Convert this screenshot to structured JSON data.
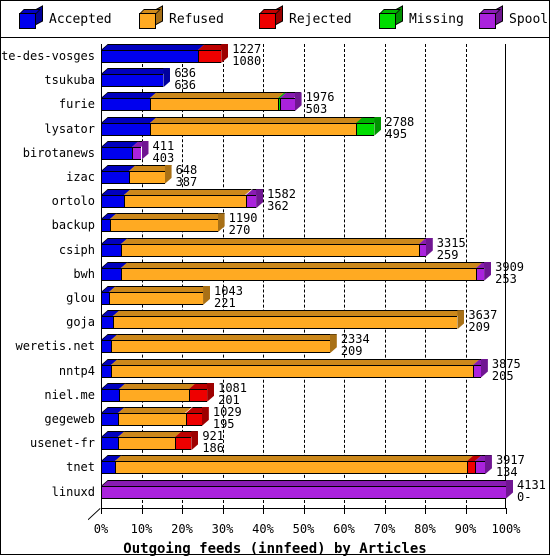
{
  "legend": {
    "items": [
      {
        "label": "Accepted",
        "color": "#0000ee",
        "icon": "cube-icon"
      },
      {
        "label": "Refused",
        "color": "#ffaa22",
        "icon": "cube-icon"
      },
      {
        "label": "Rejected",
        "color": "#ee0000",
        "icon": "cube-icon"
      },
      {
        "label": "Missing",
        "color": "#00dd00",
        "icon": "cube-icon"
      },
      {
        "label": "Spooled",
        "color": "#aa22dd",
        "icon": "cube-icon"
      }
    ]
  },
  "axis": {
    "title": "Outgoing feeds (innfeed) by Articles",
    "xticks": [
      "0%",
      "10%",
      "20%",
      "30%",
      "40%",
      "50%",
      "60%",
      "70%",
      "80%",
      "90%",
      "100%"
    ]
  },
  "chart_data": {
    "type": "bar",
    "title": "Outgoing feeds (innfeed) by Articles",
    "xlabel": "Outgoing feeds (innfeed) by Articles",
    "ylabel": "",
    "orientation": "horizontal",
    "stacked": true,
    "normalized_percent": true,
    "xlim": [
      0,
      100
    ],
    "xtick_labels": [
      "0%",
      "10%",
      "20%",
      "30%",
      "40%",
      "50%",
      "60%",
      "70%",
      "80%",
      "90%",
      "100%"
    ],
    "grid": true,
    "legend_position": "top",
    "series": [
      {
        "name": "Accepted",
        "color": "#0000ee"
      },
      {
        "name": "Refused",
        "color": "#ffaa22"
      },
      {
        "name": "Rejected",
        "color": "#ee0000"
      },
      {
        "name": "Missing",
        "color": "#00dd00"
      },
      {
        "name": "Spooled",
        "color": "#aa22dd"
      }
    ],
    "categories": [
      "bete-des-vosges",
      "tsukuba",
      "furie",
      "lysator",
      "birotanews",
      "izac",
      "ortolo",
      "backup",
      "csiph",
      "bwh",
      "glou",
      "goja",
      "weretis.net",
      "nntp4",
      "niel.me",
      "gegeweb",
      "usenet-fr",
      "tnet",
      "linuxd"
    ],
    "rows": [
      {
        "label": "bete-des-vosges",
        "total": 1227,
        "second": 1080,
        "pct_total": 29.7,
        "segments": [
          {
            "series": "Accepted",
            "pct": 24.0
          },
          {
            "series": "Rejected",
            "pct": 5.7
          }
        ]
      },
      {
        "label": "tsukuba",
        "total": 636,
        "second": 636,
        "pct_total": 15.4,
        "segments": [
          {
            "series": "Accepted",
            "pct": 15.4
          }
        ]
      },
      {
        "label": "furie",
        "total": 1976,
        "second": 503,
        "pct_total": 47.8,
        "segments": [
          {
            "series": "Accepted",
            "pct": 12.2
          },
          {
            "series": "Refused",
            "pct": 31.5
          },
          {
            "series": "Missing",
            "pct": 0.6
          },
          {
            "series": "Spooled",
            "pct": 3.5
          }
        ]
      },
      {
        "label": "lysator",
        "total": 2788,
        "second": 495,
        "pct_total": 67.5,
        "segments": [
          {
            "series": "Accepted",
            "pct": 12.0
          },
          {
            "series": "Refused",
            "pct": 51.0
          },
          {
            "series": "Missing",
            "pct": 4.5
          }
        ]
      },
      {
        "label": "birotanews",
        "total": 411,
        "second": 403,
        "pct_total": 10.0,
        "segments": [
          {
            "series": "Accepted",
            "pct": 7.7
          },
          {
            "series": "Spooled",
            "pct": 2.3
          }
        ]
      },
      {
        "label": "izac",
        "total": 648,
        "second": 387,
        "pct_total": 15.7,
        "segments": [
          {
            "series": "Accepted",
            "pct": 6.9
          },
          {
            "series": "Refused",
            "pct": 8.8
          }
        ]
      },
      {
        "label": "ortolo",
        "total": 1582,
        "second": 362,
        "pct_total": 38.3,
        "segments": [
          {
            "series": "Accepted",
            "pct": 5.8
          },
          {
            "series": "Refused",
            "pct": 29.9
          },
          {
            "series": "Spooled",
            "pct": 2.6
          }
        ]
      },
      {
        "label": "backup",
        "total": 1190,
        "second": 270,
        "pct_total": 28.8,
        "segments": [
          {
            "series": "Accepted",
            "pct": 2.2
          },
          {
            "series": "Refused",
            "pct": 26.6
          }
        ]
      },
      {
        "label": "csiph",
        "total": 3315,
        "second": 259,
        "pct_total": 80.2,
        "segments": [
          {
            "series": "Accepted",
            "pct": 5.0
          },
          {
            "series": "Refused",
            "pct": 73.5
          },
          {
            "series": "Spooled",
            "pct": 1.7
          }
        ]
      },
      {
        "label": "bwh",
        "total": 3909,
        "second": 253,
        "pct_total": 94.6,
        "segments": [
          {
            "series": "Accepted",
            "pct": 5.0
          },
          {
            "series": "Refused",
            "pct": 87.6
          },
          {
            "series": "Spooled",
            "pct": 2.0
          }
        ]
      },
      {
        "label": "glou",
        "total": 1043,
        "second": 221,
        "pct_total": 25.2,
        "segments": [
          {
            "series": "Accepted",
            "pct": 2.0
          },
          {
            "series": "Refused",
            "pct": 23.2
          }
        ]
      },
      {
        "label": "goja",
        "total": 3637,
        "second": 209,
        "pct_total": 88.0,
        "segments": [
          {
            "series": "Accepted",
            "pct": 3.0
          },
          {
            "series": "Refused",
            "pct": 85.0
          }
        ]
      },
      {
        "label": "weretis.net",
        "total": 2334,
        "second": 209,
        "pct_total": 56.5,
        "segments": [
          {
            "series": "Accepted",
            "pct": 2.5
          },
          {
            "series": "Refused",
            "pct": 54.0
          }
        ]
      },
      {
        "label": "nntp4",
        "total": 3875,
        "second": 205,
        "pct_total": 93.8,
        "segments": [
          {
            "series": "Accepted",
            "pct": 2.5
          },
          {
            "series": "Refused",
            "pct": 89.3
          },
          {
            "series": "Spooled",
            "pct": 2.0
          }
        ]
      },
      {
        "label": "niel.me",
        "total": 1081,
        "second": 201,
        "pct_total": 26.2,
        "segments": [
          {
            "series": "Accepted",
            "pct": 4.5
          },
          {
            "series": "Refused",
            "pct": 17.2
          },
          {
            "series": "Rejected",
            "pct": 4.5
          }
        ]
      },
      {
        "label": "gegeweb",
        "total": 1029,
        "second": 195,
        "pct_total": 24.9,
        "segments": [
          {
            "series": "Accepted",
            "pct": 4.3
          },
          {
            "series": "Refused",
            "pct": 16.6
          },
          {
            "series": "Rejected",
            "pct": 4.0
          }
        ]
      },
      {
        "label": "usenet-fr",
        "total": 921,
        "second": 186,
        "pct_total": 22.3,
        "segments": [
          {
            "series": "Accepted",
            "pct": 4.3
          },
          {
            "series": "Refused",
            "pct": 14.0
          },
          {
            "series": "Rejected",
            "pct": 4.0
          }
        ]
      },
      {
        "label": "tnet",
        "total": 3917,
        "second": 134,
        "pct_total": 94.8,
        "segments": [
          {
            "series": "Accepted",
            "pct": 3.5
          },
          {
            "series": "Refused",
            "pct": 86.8
          },
          {
            "series": "Rejected",
            "pct": 2.0
          },
          {
            "series": "Spooled",
            "pct": 2.5
          }
        ]
      },
      {
        "label": "linuxd",
        "total": 4131,
        "second": 0,
        "pct_total": 100.0,
        "segments": [
          {
            "series": "Spooled",
            "pct": 100.0
          }
        ]
      }
    ]
  }
}
